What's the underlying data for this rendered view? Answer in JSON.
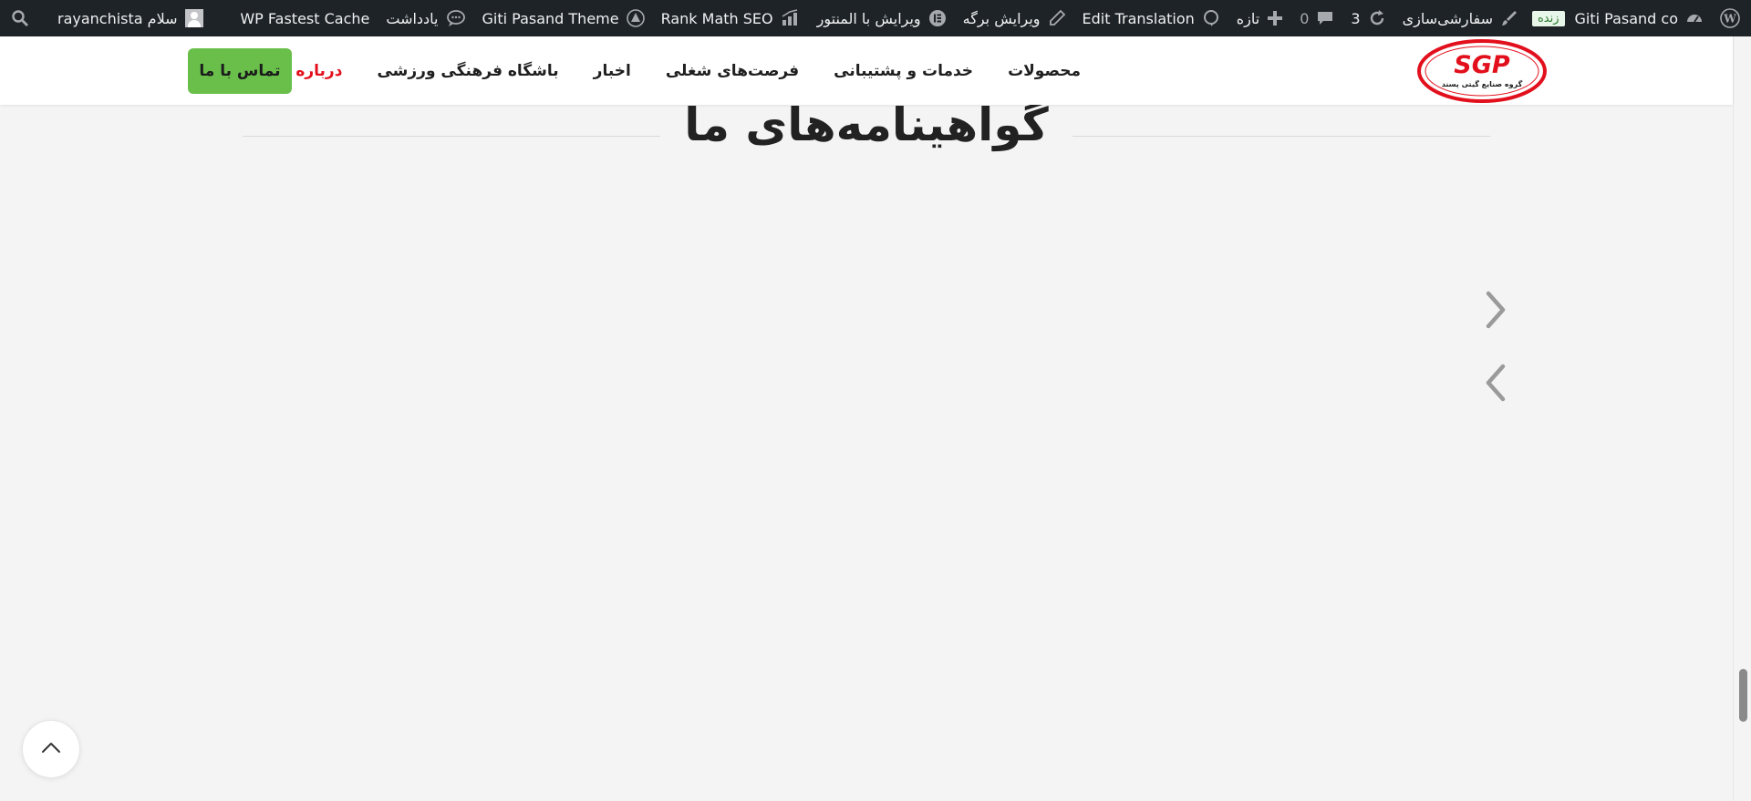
{
  "admin_bar": {
    "site_name": "Giti Pasand co",
    "live_badge": "زنده",
    "customize": "سفارشی‌سازی",
    "updates_count": "3",
    "comments_count": "0",
    "new_label": "تازه",
    "edit_translation": "Edit Translation",
    "edit_page": "ویرایش برگه",
    "edit_elementor": "ویرایش با المنتور",
    "rank_math": "Rank Math SEO",
    "theme": "Giti Pasand Theme",
    "notes": "یادداشت",
    "fastest_cache": "WP Fastest Cache",
    "greeting": "سلام rayanchista"
  },
  "header": {
    "logo_text": "SGP",
    "logo_subtext": "گروه صنایع گیتی پسند",
    "nav": [
      {
        "label": "محصولات"
      },
      {
        "label": "خدمات و پشتیبانی"
      },
      {
        "label": "فرصت‌های شغلی"
      },
      {
        "label": "اخبار"
      },
      {
        "label": "باشگاه فرهنگی ورزشی"
      },
      {
        "label": "درباره ما",
        "active": true
      }
    ],
    "cta": "تماس با ما"
  },
  "main": {
    "section_title": "گواهینامه‌های ما"
  },
  "colors": {
    "admin_bar_bg": "#1d2327",
    "accent_red": "#e2101c",
    "cta_green": "#6abf4b",
    "page_bg": "#f4f4f4"
  },
  "icons": {
    "wp_logo": "wordpress-icon",
    "dashboard": "dashboard-icon",
    "customize": "brush-icon",
    "updates": "refresh-icon",
    "comments": "comment-icon",
    "new": "plus-icon",
    "translation": "translate-icon",
    "edit": "pencil-icon",
    "elementor": "elementor-icon",
    "rank_math": "rank-math-icon",
    "theme": "tree-icon",
    "notes": "chat-icon",
    "search": "search-icon",
    "next": "chevron-right-icon",
    "prev": "chevron-left-icon",
    "top": "chevron-up-icon"
  }
}
